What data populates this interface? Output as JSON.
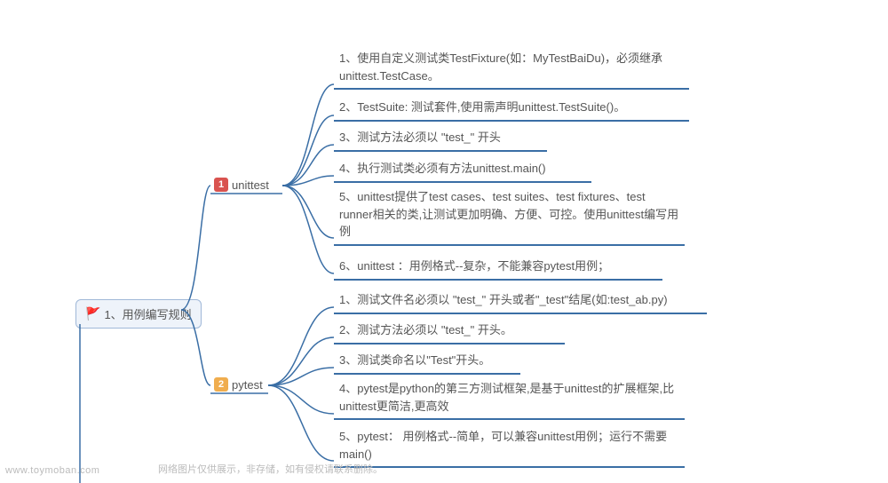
{
  "root": {
    "label": "1、用例编写规则"
  },
  "branches": [
    {
      "num": "1",
      "label": "unittest"
    },
    {
      "num": "2",
      "label": "pytest"
    }
  ],
  "leaves": {
    "unittest": [
      "1、使用自定义测试类TestFixture(如：MyTestBaiDu)，必须继承unittest.TestCase。",
      "2、TestSuite: 测试套件,使用需声明unittest.TestSuite()。",
      "3、测试方法必须以 \"test_\" 开头",
      "4、执行测试类必须有方法unittest.main()",
      "5、unittest提供了test cases、test suites、test fixtures、test runner相关的类,让测试更加明确、方便、可控。使用unittest编写用例",
      "6、unittest ：用例格式--复杂，不能兼容pytest用例；"
    ],
    "pytest": [
      "1、测试文件名必须以 \"test_\" 开头或者\"_test\"结尾(如:test_ab.py)",
      "2、测试方法必须以 \"test_\" 开头。",
      "3、测试类命名以\"Test\"开头。",
      "4、pytest是python的第三方测试框架,是基于unittest的扩展框架,比unittest更简洁,更高效",
      "5、pytest：   用例格式--简单，可以兼容unittest用例；运行不需要main()"
    ]
  },
  "watermark": "www.toymoban.com",
  "note": "网络图片仅供展示，非存储，如有侵权请联系删除。"
}
